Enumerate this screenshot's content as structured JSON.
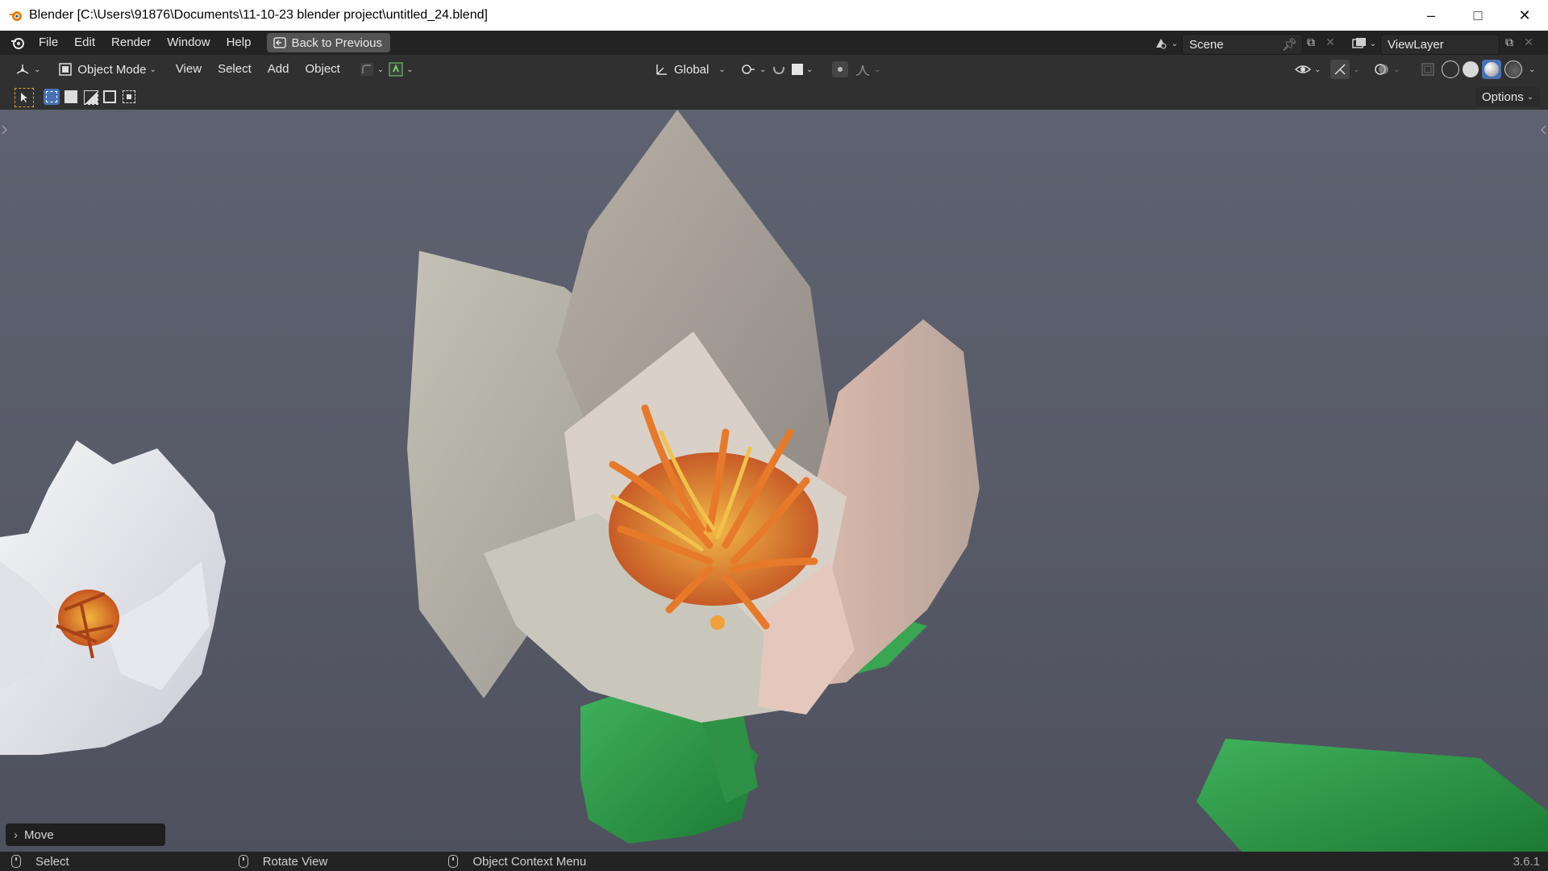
{
  "window": {
    "title": "Blender [C:\\Users\\91876\\Documents\\11-10-23 blender project\\untitled_24.blend]",
    "controls": [
      "–",
      "□",
      "✕"
    ]
  },
  "menu": {
    "items": [
      "File",
      "Edit",
      "Render",
      "Window",
      "Help"
    ],
    "back_button": "Back to Previous"
  },
  "scene": {
    "name": "Scene",
    "view_layer": "ViewLayer"
  },
  "header": {
    "mode": "Object Mode",
    "menus": [
      "View",
      "Select",
      "Add",
      "Object"
    ],
    "transform_orientation": "Global"
  },
  "toolbar": {
    "options_label": "Options"
  },
  "viewport": {
    "operator_panel": "Move",
    "accent_color": "#e8a33a"
  },
  "statusbar": {
    "left": "Select",
    "middle": "Rotate View",
    "right": "Object Context Menu",
    "version": "3.6.1"
  }
}
